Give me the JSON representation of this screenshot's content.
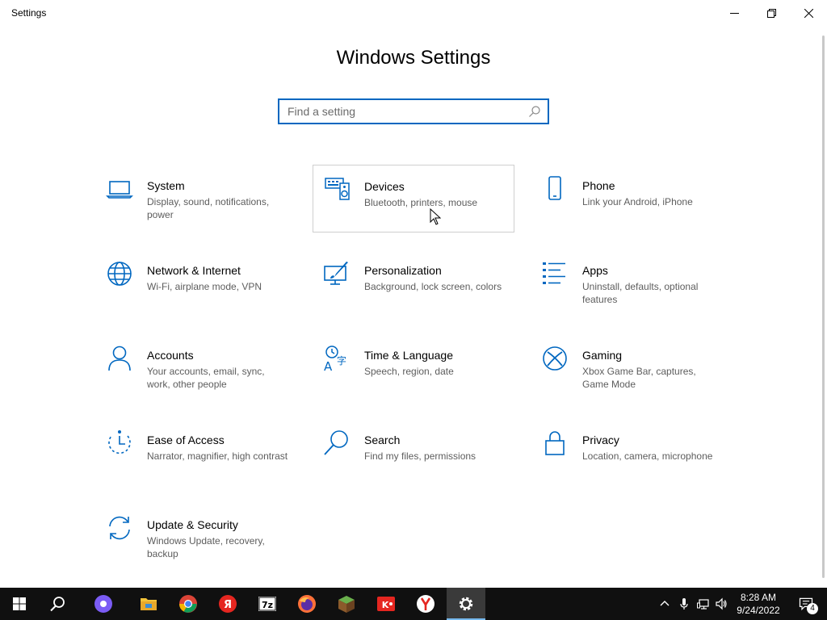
{
  "window": {
    "title": "Settings",
    "minimize_icon": "minimize-icon",
    "maximize_icon": "restore-icon",
    "close_icon": "close-icon"
  },
  "page": {
    "title": "Windows Settings"
  },
  "search": {
    "placeholder": "Find a setting",
    "value": "",
    "icon": "search-icon"
  },
  "accent_color": "#0067c0",
  "tiles": [
    {
      "label": "System",
      "desc": "Display, sound, notifications, power",
      "icon": "laptop-icon"
    },
    {
      "label": "Devices",
      "desc": "Bluetooth, printers, mouse",
      "icon": "keyboard-speaker-icon",
      "hovered": true
    },
    {
      "label": "Phone",
      "desc": "Link your Android, iPhone",
      "icon": "phone-icon"
    },
    {
      "label": "Network & Internet",
      "desc": "Wi-Fi, airplane mode, VPN",
      "icon": "globe-icon"
    },
    {
      "label": "Personalization",
      "desc": "Background, lock screen, colors",
      "icon": "paint-monitor-icon"
    },
    {
      "label": "Apps",
      "desc": "Uninstall, defaults, optional features",
      "icon": "apps-list-icon"
    },
    {
      "label": "Accounts",
      "desc": "Your accounts, email, sync, work, other people",
      "icon": "person-icon"
    },
    {
      "label": "Time & Language",
      "desc": "Speech, region, date",
      "icon": "time-language-icon"
    },
    {
      "label": "Gaming",
      "desc": "Xbox Game Bar, captures, Game Mode",
      "icon": "xbox-icon"
    },
    {
      "label": "Ease of Access",
      "desc": "Narrator, magnifier, high contrast",
      "icon": "ease-of-access-icon"
    },
    {
      "label": "Search",
      "desc": "Find my files, permissions",
      "icon": "magnifier-icon"
    },
    {
      "label": "Privacy",
      "desc": "Location, camera, microphone",
      "icon": "lock-icon"
    },
    {
      "label": "Update & Security",
      "desc": "Windows Update, recovery, backup",
      "icon": "sync-arrows-icon"
    }
  ],
  "taskbar": {
    "apps": [
      {
        "name": "start",
        "icon": "windows-logo-icon"
      },
      {
        "name": "search",
        "icon": "search-icon"
      },
      {
        "name": "alice",
        "icon": "alice-assistant-icon"
      },
      {
        "name": "file-explorer",
        "icon": "folder-icon"
      },
      {
        "name": "chrome",
        "icon": "chrome-icon"
      },
      {
        "name": "yandex-app",
        "icon": "yandex-red-icon"
      },
      {
        "name": "7zip",
        "icon": "7zip-icon",
        "text": "7z"
      },
      {
        "name": "firefox",
        "icon": "firefox-icon"
      },
      {
        "name": "minecraft",
        "icon": "minecraft-icon"
      },
      {
        "name": "kinopoisk",
        "icon": "kinopoisk-icon"
      },
      {
        "name": "yandex-browser",
        "icon": "yandex-browser-icon"
      },
      {
        "name": "settings",
        "icon": "gear-icon",
        "active": true
      }
    ],
    "tray": {
      "icons": [
        "chevron-up-icon",
        "microphone-icon",
        "network-icon",
        "volume-icon"
      ],
      "time": "8:28 AM",
      "date": "9/24/2022",
      "notification_count": "4"
    }
  }
}
